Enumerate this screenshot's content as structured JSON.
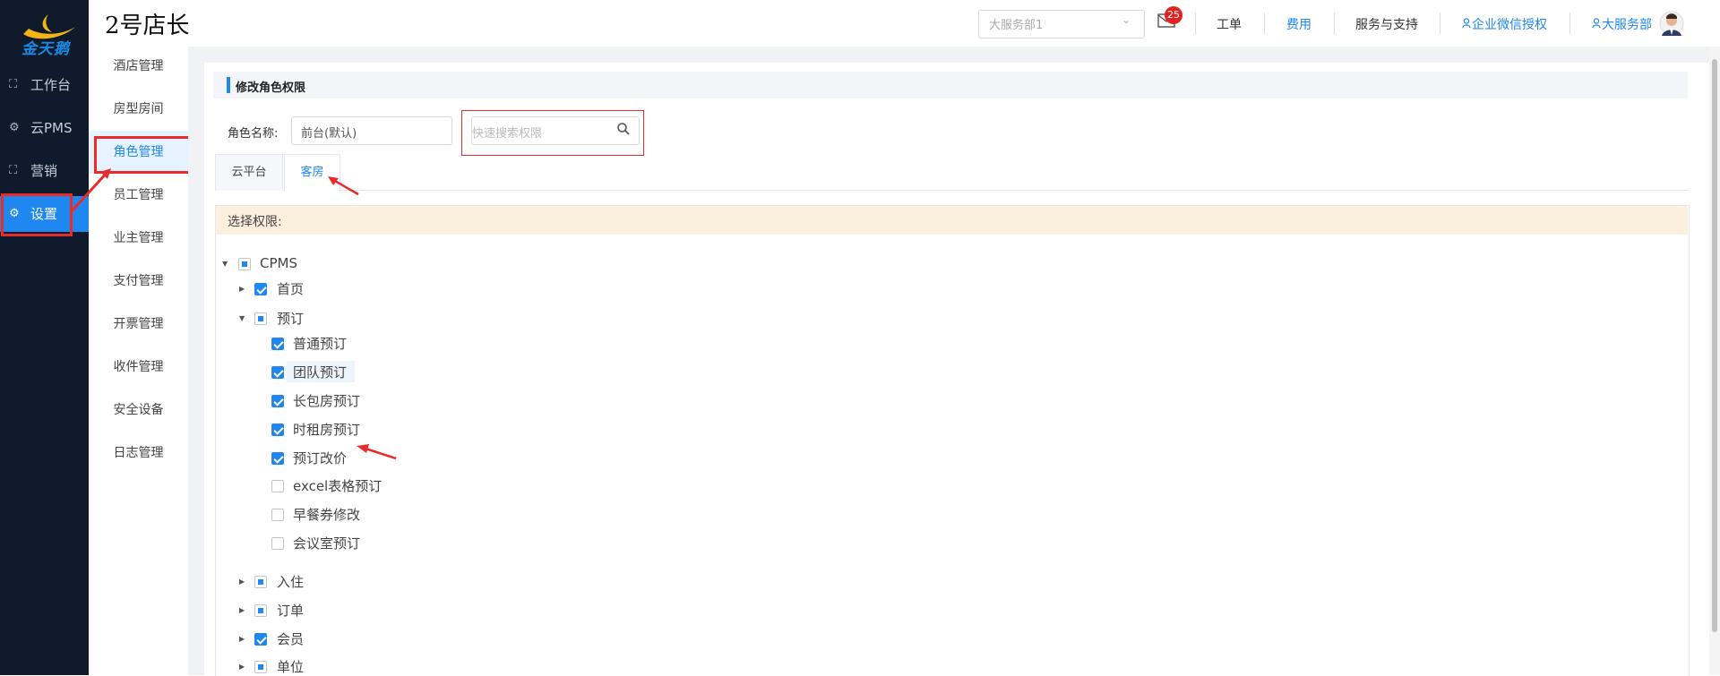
{
  "app": {
    "logo_text": "金天鹅",
    "title": "2号店长"
  },
  "leftnav": {
    "items": [
      {
        "icon": "dashboard-icon",
        "label": "工作台"
      },
      {
        "icon": "settings-gear-icon",
        "label": "云PMS"
      },
      {
        "icon": "dashboard-icon",
        "label": "营销"
      },
      {
        "icon": "settings-gear-icon",
        "label": "设置",
        "active": true
      }
    ]
  },
  "submenu": {
    "items": [
      "酒店管理",
      "房型房间",
      "角色管理",
      "员工管理",
      "业主管理",
      "支付管理",
      "开票管理",
      "收件管理",
      "安全设备",
      "日志管理"
    ],
    "active_index": 2
  },
  "header": {
    "store_select": "大服务部1",
    "mail_badge": "25",
    "links": [
      "工单",
      "费用",
      "服务与支持",
      "企业微信授权",
      "大服务部"
    ]
  },
  "page": {
    "section_title": "修改角色权限",
    "role_label": "角色名称:",
    "role_value": "前台(默认)",
    "search_placeholder": "快速搜索权限",
    "tabs": [
      "云平台",
      "客房"
    ],
    "active_tab": 1,
    "perm_header": "选择权限:"
  },
  "tree": {
    "root": {
      "label": "CPMS",
      "state": "partial"
    },
    "nodes": [
      {
        "label": "首页",
        "state": "checked"
      },
      {
        "label": "预订",
        "state": "partial",
        "expanded": true
      },
      {
        "label": "普通预订",
        "state": "checked"
      },
      {
        "label": "团队预订",
        "state": "checked"
      },
      {
        "label": "长包房预订",
        "state": "checked"
      },
      {
        "label": "时租房预订",
        "state": "checked"
      },
      {
        "label": "预订改价",
        "state": "checked"
      },
      {
        "label": "excel表格预订",
        "state": "unchecked"
      },
      {
        "label": "早餐券修改",
        "state": "unchecked"
      },
      {
        "label": "会议室预订",
        "state": "unchecked"
      },
      {
        "label": "入住",
        "state": "partial"
      },
      {
        "label": "订单",
        "state": "partial"
      },
      {
        "label": "会员",
        "state": "checked"
      },
      {
        "label": "单位",
        "state": "partial"
      }
    ]
  },
  "colors": {
    "accent": "#1e87f0",
    "annotation": "#e82c2c",
    "nav_bg": "#0f1b2c"
  }
}
